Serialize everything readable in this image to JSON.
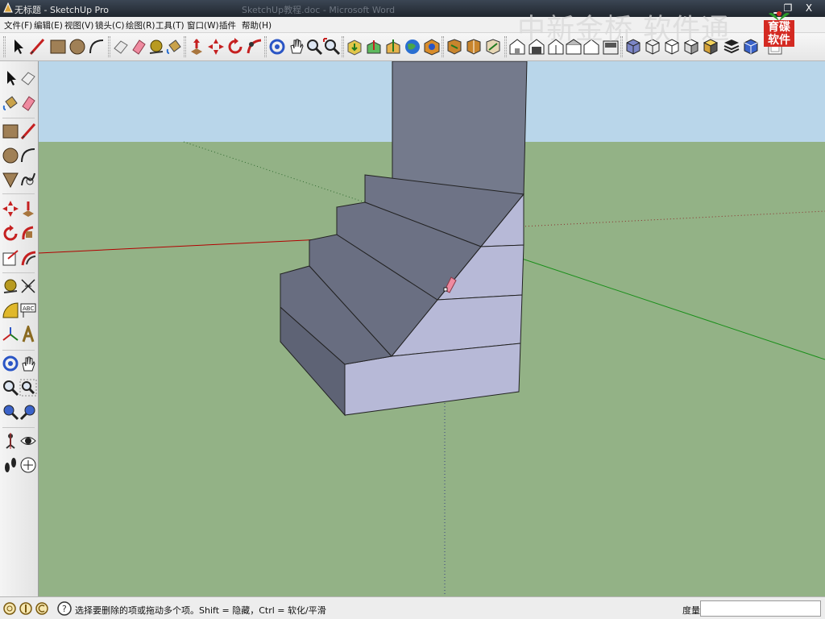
{
  "window": {
    "title": "无标题 - SketchUp Pro",
    "background_title": "SketchUp教程.doc - Microsoft Word",
    "close_glyph": "X",
    "minimize_glyph": "▁",
    "restore_glyph": "❐"
  },
  "menu": {
    "items": [
      "文件(F)",
      "编辑(E)",
      "视图(V)",
      "镜头(C)",
      "绘图(R)",
      "工具(T)",
      "窗口(W)",
      "插件",
      "帮助(H)"
    ]
  },
  "watermark": {
    "text": "中新金桥 软件通",
    "badge_text": "育碟软件"
  },
  "status": {
    "message": "选择要删除的项或拖动多个项。Shift = 隐藏，Ctrl = 软化/平滑",
    "measure_label": "度量",
    "measure_value": ""
  },
  "colors": {
    "sky": "#b9d6ea",
    "ground": "#93b286",
    "face_front": "#b7b9d7",
    "face_side": "#6e7386",
    "face_top": "#646878",
    "axis_red": "#b30000",
    "axis_green": "#1a8f1a",
    "accent_red": "#d42a22"
  },
  "icons": {
    "toolbar": [
      "select-icon",
      "pencil-line-icon",
      "rectangle-icon",
      "circle-icon",
      "arc-icon",
      "make-component-icon",
      "eraser-icon",
      "tape-measure-icon",
      "paint-bucket-icon",
      "push-pull-icon",
      "move-icon",
      "rotate-icon",
      "follow-me-icon",
      "orbit-icon",
      "pan-icon",
      "zoom-icon",
      "zoom-extents-icon",
      "get-models-icon",
      "share-model-icon",
      "upload-component-icon",
      "google-earth-icon",
      "previous-view-icon",
      "next-view-icon",
      "standard-views-icon",
      "iso-view-icon",
      "top-view-icon",
      "front-view-icon",
      "right-view-icon",
      "back-view-icon",
      "left-view-icon",
      "xray-icon",
      "wireframe-icon",
      "hidden-line-icon",
      "shaded-icon",
      "shaded-texture-icon",
      "monochrome-icon"
    ],
    "left": [
      "select-icon",
      "make-component-icon",
      "paint-bucket-icon",
      "eraser-icon",
      "rectangle-icon",
      "line-icon",
      "circle-icon",
      "arc-icon",
      "polygon-icon",
      "freehand-icon",
      "move-icon",
      "push-pull-icon",
      "rotate-icon",
      "follow-me-icon",
      "scale-icon",
      "offset-icon",
      "tape-measure-icon",
      "dimension-icon",
      "protractor-icon",
      "text-icon",
      "axes-icon",
      "3d-text-icon",
      "orbit-icon",
      "pan-icon",
      "zoom-icon",
      "zoom-window-icon",
      "zoom-extents-icon",
      "previous-icon",
      "position-camera-icon",
      "look-around-icon",
      "walk-icon",
      "section-plane-icon"
    ]
  }
}
